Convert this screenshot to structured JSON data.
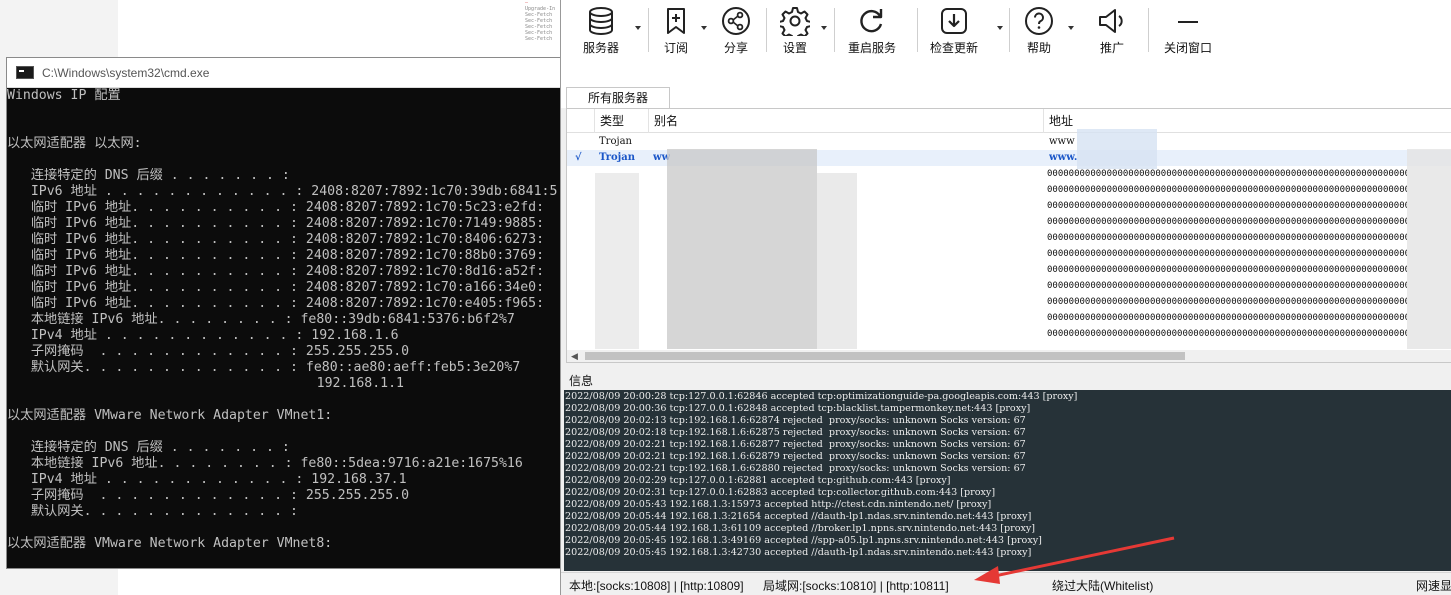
{
  "background": {
    "code_lines": [
      "Upgrade-In",
      "Sec-Fetch",
      "Sec-Fetch",
      "Sec-Fetch",
      "Sec-Fetch",
      "Sec-Fetch"
    ]
  },
  "cmd": {
    "title": "C:\\Windows\\system32\\cmd.exe",
    "lines": [
      "Windows IP 配置",
      "",
      "",
      "以太网适配器 以太网:",
      "",
      "   连接特定的 DNS 后缀 . . . . . . . :",
      "   IPv6 地址 . . . . . . . . . . . . : 2408:8207:7892:1c70:39db:6841:5",
      "   临时 IPv6 地址. . . . . . . . . . : 2408:8207:7892:1c70:5c23:e2fd:",
      "   临时 IPv6 地址. . . . . . . . . . : 2408:8207:7892:1c70:7149:9885:",
      "   临时 IPv6 地址. . . . . . . . . . : 2408:8207:7892:1c70:8406:6273:",
      "   临时 IPv6 地址. . . . . . . . . . : 2408:8207:7892:1c70:88b0:3769:",
      "   临时 IPv6 地址. . . . . . . . . . : 2408:8207:7892:1c70:8d16:a52f:",
      "   临时 IPv6 地址. . . . . . . . . . : 2408:8207:7892:1c70:a166:34e0:",
      "   临时 IPv6 地址. . . . . . . . . . : 2408:8207:7892:1c70:e405:f965:",
      "   本地链接 IPv6 地址. . . . . . . . : fe80::39db:6841:5376:b6f2%7",
      "   IPv4 地址 . . . . . . . . . . . . : 192.168.1.6",
      "   子网掩码  . . . . . . . . . . . . : 255.255.255.0",
      "   默认网关. . . . . . . . . . . . . : fe80::ae80:aeff:feb5:3e20%7",
      "                                       192.168.1.1",
      "",
      "以太网适配器 VMware Network Adapter VMnet1:",
      "",
      "   连接特定的 DNS 后缀 . . . . . . . :",
      "   本地链接 IPv6 地址. . . . . . . . : fe80::5dea:9716:a21e:1675%16",
      "   IPv4 地址 . . . . . . . . . . . . : 192.168.37.1",
      "   子网掩码  . . . . . . . . . . . . : 255.255.255.0",
      "   默认网关. . . . . . . . . . . . . :",
      "",
      "以太网适配器 VMware Network Adapter VMnet8:"
    ]
  },
  "toolbar": {
    "items": [
      {
        "label": "服务器",
        "icon": "database-icon"
      },
      {
        "label": "订阅",
        "icon": "bookmark-add-icon"
      },
      {
        "label": "分享",
        "icon": "share-icon"
      },
      {
        "label": "设置",
        "icon": "gear-icon"
      },
      {
        "label": "重启服务",
        "icon": "restart-icon"
      },
      {
        "label": "检查更新",
        "icon": "download-icon"
      },
      {
        "label": "帮助",
        "icon": "help-icon"
      },
      {
        "label": "推广",
        "icon": "speaker-icon"
      },
      {
        "label": "关闭窗口",
        "icon": "minimize-icon"
      }
    ]
  },
  "tabs": {
    "active": "所有服务器"
  },
  "grid": {
    "headers": {
      "type": "类型",
      "alias": "别名",
      "address": "地址"
    },
    "rows": [
      {
        "check": "",
        "type": "Trojan",
        "alias": "",
        "address": "www"
      },
      {
        "check": "√",
        "type": "Trojan",
        "alias": "ww",
        "address": "www."
      }
    ],
    "filler_address": "00000000000000000000000000000000000000000000000000000000000000000000000000"
  },
  "info": {
    "label": "信息",
    "log": [
      "2022/08/09 20:00:28 tcp:127.0.0.1:62846 accepted tcp:optimizationguide-pa.googleapis.com:443 [proxy]",
      "2022/08/09 20:00:36 tcp:127.0.0.1:62848 accepted tcp:blacklist.tampermonkey.net:443 [proxy]",
      "2022/08/09 20:02:13 tcp:192.168.1.6:62874 rejected  proxy/socks: unknown Socks version: 67",
      "2022/08/09 20:02:18 tcp:192.168.1.6:62875 rejected  proxy/socks: unknown Socks version: 67",
      "2022/08/09 20:02:21 tcp:192.168.1.6:62877 rejected  proxy/socks: unknown Socks version: 67",
      "2022/08/09 20:02:21 tcp:192.168.1.6:62879 rejected  proxy/socks: unknown Socks version: 67",
      "2022/08/09 20:02:21 tcp:192.168.1.6:62880 rejected  proxy/socks: unknown Socks version: 67",
      "2022/08/09 20:02:29 tcp:127.0.0.1:62881 accepted tcp:github.com:443 [proxy]",
      "2022/08/09 20:02:31 tcp:127.0.0.1:62883 accepted tcp:collector.github.com:443 [proxy]",
      "2022/08/09 20:05:43 192.168.1.3:15973 accepted http://ctest.cdn.nintendo.net/ [proxy]",
      "2022/08/09 20:05:44 192.168.1.3:21654 accepted //dauth-lp1.ndas.srv.nintendo.net:443 [proxy]",
      "2022/08/09 20:05:44 192.168.1.3:61109 accepted //broker.lp1.npns.srv.nintendo.net:443 [proxy]",
      "2022/08/09 20:05:45 192.168.1.3:49169 accepted //spp-a05.lp1.npns.srv.nintendo.net:443 [proxy]",
      "2022/08/09 20:05:45 192.168.1.3:42730 accepted //dauth-lp1.ndas.srv.nintendo.net:443 [proxy]"
    ]
  },
  "status": {
    "local": "本地:[socks:10808] | [http:10809]",
    "lan": "局域网:[socks:10810] | [http:10811]",
    "routing": "绕过大陆(Whitelist)",
    "speed": "网速显示"
  },
  "colors": {
    "log_bg": "#263238",
    "annotation_arrow": "#e53935",
    "selected_row_text": "#1a56c8"
  }
}
